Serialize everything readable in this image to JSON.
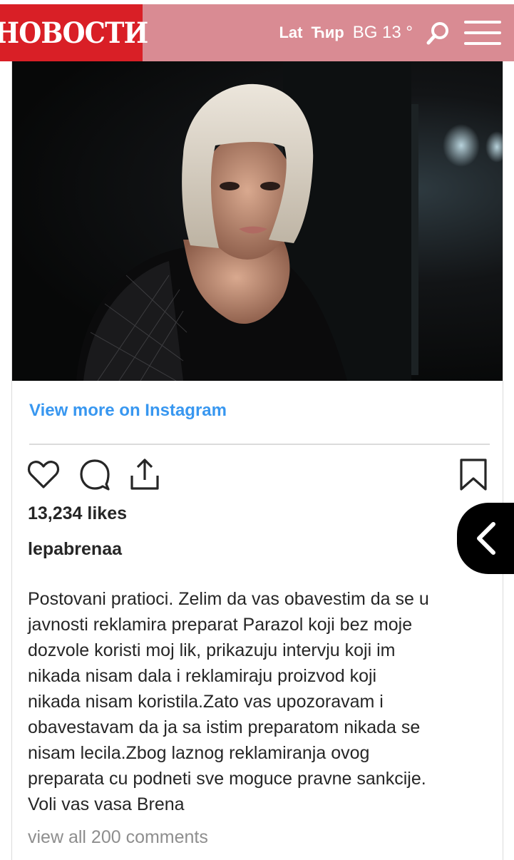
{
  "header": {
    "logo": "НОВОСТИ",
    "lat_label": "Lat",
    "cyr_label": "Ћир",
    "weather": "BG 13 °",
    "brand_color": "#d91f26",
    "bar_color": "#d98b93",
    "icons": [
      "search-icon",
      "menu-icon"
    ]
  },
  "post": {
    "view_more": "View more on Instagram",
    "likes": "13,234 likes",
    "username": "lepabrenaa",
    "caption_lines": [
      "Postovani pratioci. Zelim da vas obavestim da se u",
      "javnosti reklamira preparat Parazol koji bez moje",
      "dozvole koristi moj lik, prikazuju intervju koji im",
      "nikada nisam dala i reklamiraju proizvod koji",
      "nikada nisam koristila.Zato vas upozoravam i",
      "obavestavam da ja sa istim preparatom nikada se",
      "nisam lecila.Zbog laznog reklamiranja ovog",
      "preparata cu podneti sve moguce pravne sankcije.",
      "Voli vas vasa Brena"
    ],
    "comments_link": "view all 200 comments",
    "link_color": "#3897f0",
    "icons": [
      "heart-icon",
      "comment-icon",
      "share-icon",
      "bookmark-icon"
    ]
  },
  "side_tab": {
    "icon": "chevron-left-icon"
  }
}
